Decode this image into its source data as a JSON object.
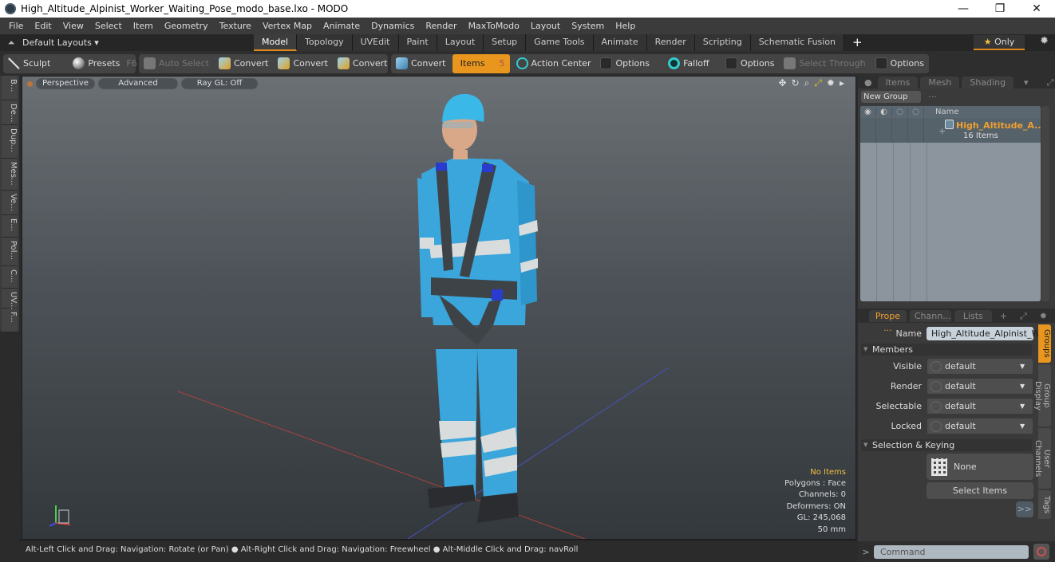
{
  "window": {
    "title": "High_Altitude_Alpinist_Worker_Waiting_Pose_modo_base.lxo - MODO",
    "controls": [
      "minimize",
      "maximize",
      "close"
    ]
  },
  "menu": [
    "File",
    "Edit",
    "View",
    "Select",
    "Item",
    "Geometry",
    "Texture",
    "Vertex Map",
    "Animate",
    "Dynamics",
    "Render",
    "MaxToModo",
    "Layout",
    "System",
    "Help"
  ],
  "layout_bar": {
    "layouts_label": "Default Layouts ▾",
    "tabs": [
      "Model",
      "Topology",
      "UVEdit",
      "Paint",
      "Layout",
      "Setup",
      "Game Tools",
      "Animate",
      "Render",
      "Scripting",
      "Schematic Fusion"
    ],
    "active_tab": "Model",
    "add_tab": "+",
    "only_label": "Only",
    "only_star": "★"
  },
  "toolbar": {
    "sculpt": "Sculpt",
    "presets": "Presets",
    "presets_key": "F6",
    "auto_select": "Auto Select",
    "convert1": "Convert",
    "convert2": "Convert",
    "convert3": "Convert",
    "convert4": "Convert",
    "items": "Items",
    "items_key": "5",
    "action_center": "Action Center",
    "options1": "Options",
    "falloff": "Falloff",
    "options2": "Options",
    "select_through": "Select Through",
    "options3": "Options"
  },
  "left_tabs": [
    "B...",
    "De...",
    "Dup...",
    "Mes...",
    "Ve...",
    "E...",
    "Pol...",
    "C...",
    "UV...",
    "F..."
  ],
  "viewport": {
    "view_mode": "Perspective",
    "shading": "Advanced",
    "raygl": "Ray GL: Off",
    "stats": {
      "selection": "No Items",
      "polygons": "Polygons : Face",
      "channels": "Channels: 0",
      "deformers": "Deformers: ON",
      "gl": "GL: 245,068",
      "unit": "50 mm"
    },
    "colors": {
      "x_axis": "#c0443a",
      "z_axis": "#4a55c8",
      "suit": "#3aa6dc",
      "stripe": "#d8dcdc"
    }
  },
  "status": {
    "hint": "Alt-Left Click and Drag: Navigation: Rotate (or Pan) ● Alt-Right Click and Drag: Navigation: Freewheel ● Alt-Middle Click and Drag: navRoll"
  },
  "groups_panel": {
    "tabs": [
      "Items",
      "Mesh ...",
      "Shading"
    ],
    "new_group": "New Group",
    "name_header": "Name",
    "group": {
      "name": "High_Altitude_A...",
      "count": "16 Items"
    }
  },
  "properties": {
    "tabs": [
      "Prope ...",
      "Chann...",
      "Lists"
    ],
    "name_label": "Name",
    "name_value": "High_Altitude_Alpinist_Wo",
    "members_section": "Members",
    "fields": [
      {
        "label": "Visible",
        "value": "default"
      },
      {
        "label": "Render",
        "value": "default"
      },
      {
        "label": "Selectable",
        "value": "default"
      },
      {
        "label": "Locked",
        "value": "default"
      }
    ],
    "keying_section": "Selection & Keying",
    "none_label": "None",
    "select_items": "Select Items",
    "more": ">>",
    "side_tabs": [
      "Groups",
      "Group Display",
      "User Channels",
      "Tags"
    ]
  },
  "command": {
    "prompt": ">",
    "placeholder": "Command"
  }
}
